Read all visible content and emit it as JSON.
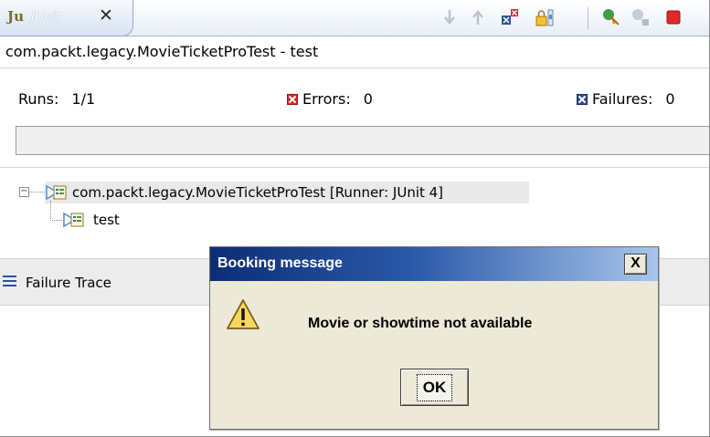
{
  "view": {
    "tab_label": "JUnit",
    "tab_icon_text": "Ju",
    "close_glyph": "✕",
    "toolbar": [
      {
        "name": "next-failure-icon"
      },
      {
        "name": "previous-failure-icon"
      },
      {
        "name": "show-failures-only-icon"
      },
      {
        "name": "scroll-lock-icon"
      },
      {
        "name": "rerun-test-icon"
      },
      {
        "name": "rerun-failed-first-icon"
      },
      {
        "name": "stop-icon"
      }
    ]
  },
  "run": {
    "title": "com.packt.legacy.MovieTicketProTest - test",
    "runs_label": "Runs:",
    "runs_value": "1/1",
    "errors_label": "Errors:",
    "errors_value": "0",
    "failures_label": "Failures:",
    "failures_value": "0"
  },
  "tree": {
    "suite_label": "com.packt.legacy.MovieTicketProTest [Runner: JUnit 4]",
    "toggle_glyph": "−",
    "test_label": "test"
  },
  "trace": {
    "label": "Failure Trace"
  },
  "dialog": {
    "title": "Booking message",
    "close_label": "X",
    "message": "Movie or showtime not available",
    "ok_label": "OK",
    "icon": "warning-icon"
  },
  "colors": {
    "dialog_title_start": "#0c2d75",
    "dialog_title_end": "#a9c5ec",
    "dialog_background": "#ece9d8",
    "error_icon": "#d62a2a",
    "failure_icon": "#2f4d9b"
  }
}
